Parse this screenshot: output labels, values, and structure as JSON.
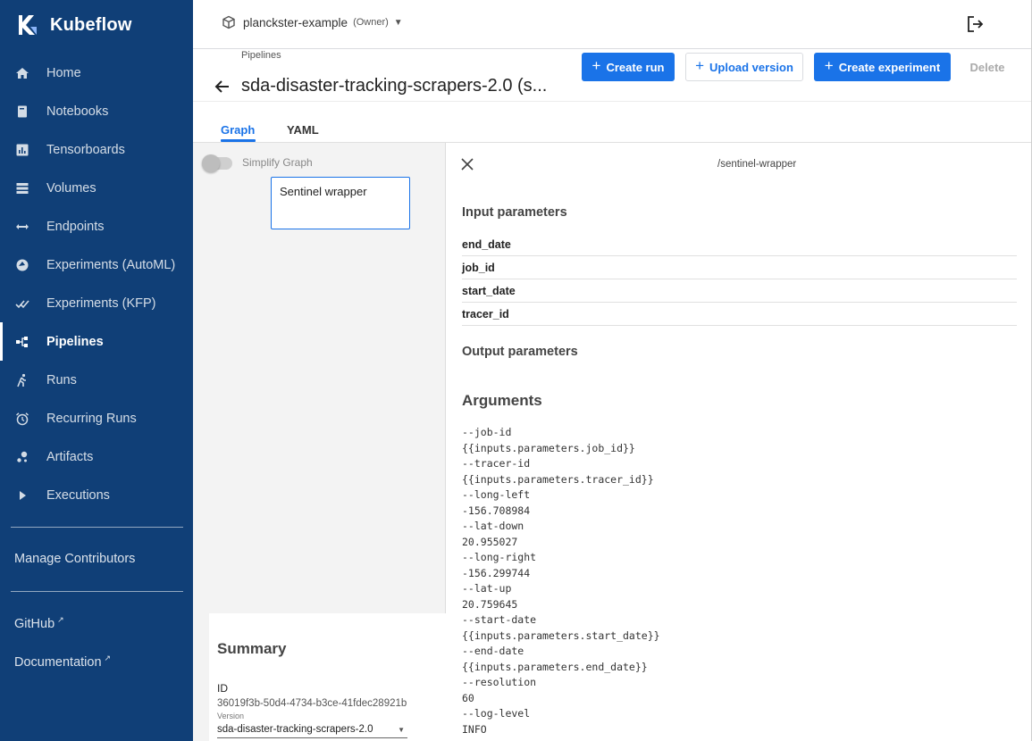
{
  "brand": {
    "name": "Kubeflow"
  },
  "sidebar": {
    "items": [
      {
        "label": "Home",
        "icon": "home-icon",
        "active": false
      },
      {
        "label": "Notebooks",
        "icon": "notebook-icon",
        "active": false
      },
      {
        "label": "Tensorboards",
        "icon": "tensorboard-icon",
        "active": false
      },
      {
        "label": "Volumes",
        "icon": "volumes-icon",
        "active": false
      },
      {
        "label": "Endpoints",
        "icon": "endpoints-icon",
        "active": false
      },
      {
        "label": "Experiments (AutoML)",
        "icon": "automl-icon",
        "active": false
      },
      {
        "label": "Experiments (KFP)",
        "icon": "kfp-icon",
        "active": false
      },
      {
        "label": "Pipelines",
        "icon": "pipelines-icon",
        "active": true
      },
      {
        "label": "Runs",
        "icon": "runs-icon",
        "active": false
      },
      {
        "label": "Recurring Runs",
        "icon": "alarm-icon",
        "active": false
      },
      {
        "label": "Artifacts",
        "icon": "artifacts-icon",
        "active": false
      },
      {
        "label": "Executions",
        "icon": "play-icon",
        "active": false
      }
    ],
    "manage_contributors": "Manage Contributors",
    "github": "GitHub",
    "documentation": "Documentation"
  },
  "topbar": {
    "namespace": "planckster-example",
    "role": "(Owner)"
  },
  "header": {
    "breadcrumb": "Pipelines",
    "title": "sda-disaster-tracking-scrapers-2.0 (s...",
    "buttons": {
      "create_run": "Create run",
      "upload_version": "Upload version",
      "create_experiment": "Create experiment",
      "delete": "Delete"
    }
  },
  "tabs": [
    {
      "label": "Graph",
      "active": true
    },
    {
      "label": "YAML",
      "active": false
    }
  ],
  "graph": {
    "simplify_label": "Simplify Graph",
    "simplify_on": false,
    "node_label": "Sentinel wrapper"
  },
  "summary": {
    "title": "Summary",
    "id_label": "ID",
    "id_value": "36019f3b-50d4-4734-b3ce-41fdec28921b",
    "version_label": "Version",
    "version_value": "sda-disaster-tracking-scrapers-2.0"
  },
  "panel": {
    "title": "/sentinel-wrapper",
    "input_heading": "Input parameters",
    "inputs": [
      "end_date",
      "job_id",
      "start_date",
      "tracer_id"
    ],
    "output_heading": "Output parameters",
    "arguments_heading": "Arguments",
    "arguments": [
      "--job-id",
      "{{inputs.parameters.job_id}}",
      "--tracer-id",
      "{{inputs.parameters.tracer_id}}",
      "--long-left",
      "-156.708984",
      "--lat-down",
      "20.955027",
      "--long-right",
      "-156.299744",
      "--lat-up",
      "20.759645",
      "--start-date",
      "{{inputs.parameters.start_date}}",
      "--end-date",
      "{{inputs.parameters.end_date}}",
      "--resolution",
      "60",
      "--log-level",
      "INFO"
    ]
  },
  "colors": {
    "sidebar_bg": "#103f77",
    "primary": "#1a73e8",
    "graph_bg": "#f3f3f3"
  }
}
